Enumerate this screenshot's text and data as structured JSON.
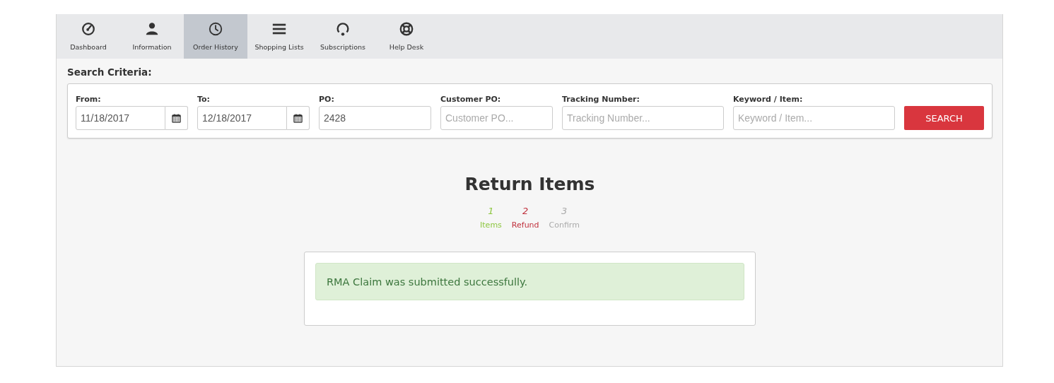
{
  "tabs": [
    {
      "label": "Dashboard",
      "kind": "gauge",
      "selected": false
    },
    {
      "label": "Information",
      "kind": "person",
      "selected": false
    },
    {
      "label": "Order History",
      "kind": "clock",
      "selected": true
    },
    {
      "label": "Shopping Lists",
      "kind": "list",
      "selected": false
    },
    {
      "label": "Subscriptions",
      "kind": "refresh",
      "selected": false
    },
    {
      "label": "Help Desk",
      "kind": "lifebuoy",
      "selected": false
    }
  ],
  "search_criteria": {
    "title": "Search Criteria:",
    "fields": [
      {
        "label": "From:",
        "value": "11/18/2017",
        "kind": "date"
      },
      {
        "label": "To:",
        "value": "12/18/2017",
        "kind": "date"
      },
      {
        "label": "PO:",
        "value": "2428",
        "kind": "text"
      },
      {
        "label": "Customer PO:",
        "placeholder": "Customer PO...",
        "kind": "text"
      },
      {
        "label": "Tracking Number:",
        "placeholder": "Tracking Number...",
        "kind": "wide"
      },
      {
        "label": "Keyword / Item:",
        "placeholder": "Keyword / Item...",
        "kind": "wide"
      }
    ],
    "button": "SEARCH"
  },
  "heading": "Return Items",
  "steps": [
    {
      "number": "1",
      "label": "Items",
      "kind": "done"
    },
    {
      "number": "2",
      "label": "Refund",
      "kind": "current"
    },
    {
      "number": "3",
      "label": "Confirm",
      "kind": "pending"
    }
  ],
  "alert": {
    "message": "RMA Claim was submitted successfully."
  }
}
